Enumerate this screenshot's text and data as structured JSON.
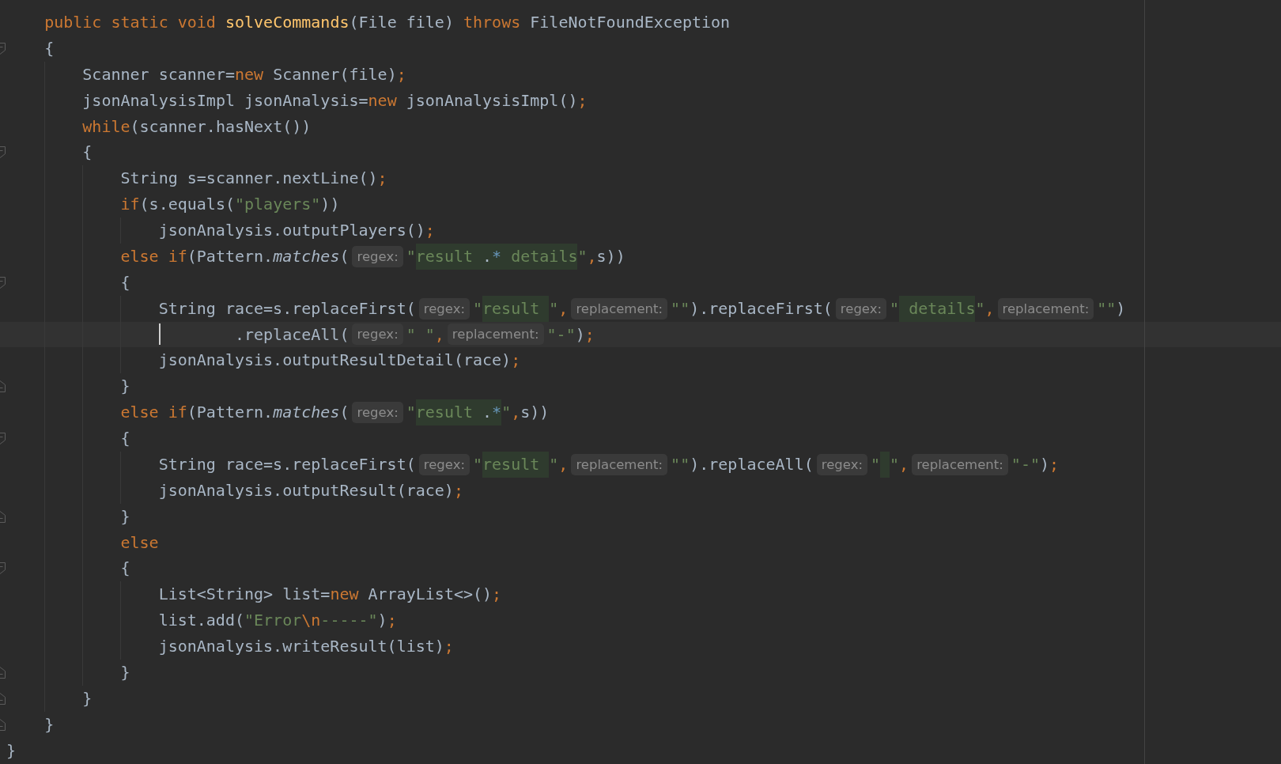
{
  "editor": {
    "lines": [
      {
        "kind": "statement",
        "current": false,
        "tokens": [
          {
            "kind": "keyword",
            "text": "public static void "
          },
          {
            "kind": "method_decl",
            "text": "solveCommands"
          },
          {
            "kind": "plain",
            "text": "(File file) "
          },
          {
            "kind": "keyword",
            "text": "throws "
          },
          {
            "kind": "plain",
            "text": "FileNotFoundException"
          }
        ]
      },
      {
        "kind": "statement",
        "current": false,
        "fold_start": true,
        "tokens": [
          {
            "kind": "plain",
            "text": "{"
          }
        ],
        "children": [
          {
            "kind": "statement",
            "current": false,
            "tokens": [
              {
                "kind": "plain",
                "text": "Scanner scanner="
              },
              {
                "kind": "keyword",
                "text": "new "
              },
              {
                "kind": "plain",
                "text": "Scanner(file)"
              },
              {
                "kind": "separator",
                "text": ";"
              }
            ]
          },
          {
            "kind": "statement",
            "current": false,
            "tokens": [
              {
                "kind": "plain",
                "text": "jsonAnalysisImpl jsonAnalysis="
              },
              {
                "kind": "keyword",
                "text": "new "
              },
              {
                "kind": "plain",
                "text": "jsonAnalysisImpl()"
              },
              {
                "kind": "separator",
                "text": ";"
              }
            ]
          },
          {
            "kind": "statement",
            "current": false,
            "tokens": [
              {
                "kind": "keyword",
                "text": "while"
              },
              {
                "kind": "plain",
                "text": "(scanner.hasNext())"
              }
            ]
          },
          {
            "kind": "statement",
            "current": false,
            "fold_start": true,
            "tokens": [
              {
                "kind": "plain",
                "text": "{"
              }
            ],
            "children": [
              {
                "kind": "statement",
                "current": false,
                "tokens": [
                  {
                    "kind": "plain",
                    "text": "String s=scanner.nextLine()"
                  },
                  {
                    "kind": "separator",
                    "text": ";"
                  }
                ]
              },
              {
                "kind": "statement",
                "current": false,
                "tokens": [
                  {
                    "kind": "keyword",
                    "text": "if"
                  },
                  {
                    "kind": "plain",
                    "text": "(s.equals("
                  },
                  {
                    "kind": "string",
                    "text": "\"players\""
                  },
                  {
                    "kind": "plain",
                    "text": "))"
                  }
                ],
                "children": [
                  {
                    "kind": "statement",
                    "current": false,
                    "tokens": [
                      {
                        "kind": "plain",
                        "text": "jsonAnalysis.outputPlayers()"
                      },
                      {
                        "kind": "separator",
                        "text": ";"
                      }
                    ]
                  }
                ]
              },
              {
                "kind": "statement",
                "current": false,
                "tokens": [
                  {
                    "kind": "keyword",
                    "text": "else if"
                  },
                  {
                    "kind": "plain",
                    "text": "(Pattern."
                  },
                  {
                    "kind": "static_call",
                    "text": "matches"
                  },
                  {
                    "kind": "plain",
                    "text": "("
                  },
                  {
                    "kind": "hint",
                    "text": "regex:"
                  },
                  {
                    "kind": "string",
                    "text": "\""
                  },
                  {
                    "kind": "regex",
                    "text": "result "
                  },
                  {
                    "kind": "regex_char",
                    "text": "."
                  },
                  {
                    "kind": "regex_quantifier",
                    "text": "*"
                  },
                  {
                    "kind": "regex",
                    "text": " details"
                  },
                  {
                    "kind": "string",
                    "text": "\""
                  },
                  {
                    "kind": "separator",
                    "text": ","
                  },
                  {
                    "kind": "plain",
                    "text": "s))"
                  }
                ]
              },
              {
                "kind": "statement",
                "current": false,
                "fold_start": true,
                "tokens": [
                  {
                    "kind": "plain",
                    "text": "{"
                  }
                ],
                "children": [
                  {
                    "kind": "statement",
                    "current": false,
                    "tokens": [
                      {
                        "kind": "plain",
                        "text": "String race=s.replaceFirst("
                      },
                      {
                        "kind": "hint",
                        "text": "regex:"
                      },
                      {
                        "kind": "string",
                        "text": "\""
                      },
                      {
                        "kind": "regex",
                        "text": "result "
                      },
                      {
                        "kind": "string",
                        "text": "\""
                      },
                      {
                        "kind": "separator",
                        "text": ","
                      },
                      {
                        "kind": "hint",
                        "text": "replacement:"
                      },
                      {
                        "kind": "string",
                        "text": "\"\""
                      },
                      {
                        "kind": "plain",
                        "text": ").replaceFirst("
                      },
                      {
                        "kind": "hint",
                        "text": "regex:"
                      },
                      {
                        "kind": "string",
                        "text": "\""
                      },
                      {
                        "kind": "regex",
                        "text": " details"
                      },
                      {
                        "kind": "string",
                        "text": "\""
                      },
                      {
                        "kind": "separator",
                        "text": ","
                      },
                      {
                        "kind": "hint",
                        "text": "replacement:"
                      },
                      {
                        "kind": "string",
                        "text": "\"\""
                      },
                      {
                        "kind": "plain",
                        "text": ")"
                      }
                    ]
                  },
                  {
                    "kind": "continuation",
                    "current": true,
                    "tokens": [
                      {
                        "kind": "plain",
                        "text": ".replaceAll("
                      },
                      {
                        "kind": "hint",
                        "text": "regex:"
                      },
                      {
                        "kind": "string",
                        "text": "\" \""
                      },
                      {
                        "kind": "separator",
                        "text": ","
                      },
                      {
                        "kind": "hint",
                        "text": "replacement:"
                      },
                      {
                        "kind": "string",
                        "text": "\"-\""
                      },
                      {
                        "kind": "plain",
                        "text": ")"
                      },
                      {
                        "kind": "separator",
                        "text": ";"
                      }
                    ]
                  },
                  {
                    "kind": "statement",
                    "current": false,
                    "tokens": [
                      {
                        "kind": "plain",
                        "text": "jsonAnalysis.outputResultDetail(race)"
                      },
                      {
                        "kind": "separator",
                        "text": ";"
                      }
                    ]
                  }
                ]
              },
              {
                "kind": "statement",
                "current": false,
                "fold_end": true,
                "tokens": [
                  {
                    "kind": "plain",
                    "text": "}"
                  }
                ]
              },
              {
                "kind": "statement",
                "current": false,
                "tokens": [
                  {
                    "kind": "keyword",
                    "text": "else if"
                  },
                  {
                    "kind": "plain",
                    "text": "(Pattern."
                  },
                  {
                    "kind": "static_call",
                    "text": "matches"
                  },
                  {
                    "kind": "plain",
                    "text": "("
                  },
                  {
                    "kind": "hint",
                    "text": "regex:"
                  },
                  {
                    "kind": "string",
                    "text": "\""
                  },
                  {
                    "kind": "regex",
                    "text": "result "
                  },
                  {
                    "kind": "regex_char",
                    "text": "."
                  },
                  {
                    "kind": "regex_quantifier",
                    "text": "*"
                  },
                  {
                    "kind": "string",
                    "text": "\""
                  },
                  {
                    "kind": "separator",
                    "text": ","
                  },
                  {
                    "kind": "plain",
                    "text": "s))"
                  }
                ]
              },
              {
                "kind": "statement",
                "current": false,
                "fold_start": true,
                "tokens": [
                  {
                    "kind": "plain",
                    "text": "{"
                  }
                ],
                "children": [
                  {
                    "kind": "statement",
                    "current": false,
                    "tokens": [
                      {
                        "kind": "plain",
                        "text": "String race=s.replaceFirst("
                      },
                      {
                        "kind": "hint",
                        "text": "regex:"
                      },
                      {
                        "kind": "string",
                        "text": "\""
                      },
                      {
                        "kind": "regex",
                        "text": "result "
                      },
                      {
                        "kind": "string",
                        "text": "\""
                      },
                      {
                        "kind": "separator",
                        "text": ","
                      },
                      {
                        "kind": "hint",
                        "text": "replacement:"
                      },
                      {
                        "kind": "string",
                        "text": "\"\""
                      },
                      {
                        "kind": "plain",
                        "text": ").replaceAll("
                      },
                      {
                        "kind": "hint",
                        "text": "regex:"
                      },
                      {
                        "kind": "regex_string",
                        "text": "\" \""
                      },
                      {
                        "kind": "separator",
                        "text": ","
                      },
                      {
                        "kind": "hint",
                        "text": "replacement:"
                      },
                      {
                        "kind": "string",
                        "text": "\"-\""
                      },
                      {
                        "kind": "plain",
                        "text": ")"
                      },
                      {
                        "kind": "separator",
                        "text": ";"
                      }
                    ]
                  },
                  {
                    "kind": "statement",
                    "current": false,
                    "tokens": [
                      {
                        "kind": "plain",
                        "text": "jsonAnalysis.outputResult(race)"
                      },
                      {
                        "kind": "separator",
                        "text": ";"
                      }
                    ]
                  }
                ]
              },
              {
                "kind": "statement",
                "current": false,
                "fold_end": true,
                "tokens": [
                  {
                    "kind": "plain",
                    "text": "}"
                  }
                ]
              },
              {
                "kind": "statement",
                "current": false,
                "tokens": [
                  {
                    "kind": "keyword",
                    "text": "else"
                  }
                ]
              },
              {
                "kind": "statement",
                "current": false,
                "fold_start": true,
                "tokens": [
                  {
                    "kind": "plain",
                    "text": "{"
                  }
                ],
                "children": [
                  {
                    "kind": "statement",
                    "current": false,
                    "tokens": [
                      {
                        "kind": "plain",
                        "text": "List<String> list="
                      },
                      {
                        "kind": "keyword",
                        "text": "new "
                      },
                      {
                        "kind": "plain",
                        "text": "ArrayList<>()"
                      },
                      {
                        "kind": "separator",
                        "text": ";"
                      }
                    ]
                  },
                  {
                    "kind": "statement",
                    "current": false,
                    "tokens": [
                      {
                        "kind": "plain",
                        "text": "list.add("
                      },
                      {
                        "kind": "string",
                        "text": "\"Error"
                      },
                      {
                        "kind": "escape",
                        "text": "\\n"
                      },
                      {
                        "kind": "string",
                        "text": "-----\""
                      },
                      {
                        "kind": "plain",
                        "text": ")"
                      },
                      {
                        "kind": "separator",
                        "text": ";"
                      }
                    ]
                  },
                  {
                    "kind": "statement",
                    "current": false,
                    "tokens": [
                      {
                        "kind": "plain",
                        "text": "jsonAnalysis.writeResult(list)"
                      },
                      {
                        "kind": "separator",
                        "text": ";"
                      }
                    ]
                  }
                ]
              },
              {
                "kind": "statement",
                "current": false,
                "fold_end": true,
                "tokens": [
                  {
                    "kind": "plain",
                    "text": "}"
                  }
                ]
              }
            ]
          },
          {
            "kind": "statement",
            "current": false,
            "fold_end": true,
            "tokens": [
              {
                "kind": "plain",
                "text": "}"
              }
            ]
          }
        ]
      },
      {
        "kind": "statement",
        "current": false,
        "fold_end": true,
        "tokens": [
          {
            "kind": "plain",
            "text": "}"
          }
        ]
      }
    ],
    "class_end": {
      "kind": "statement",
      "current": false,
      "tokens": [
        {
          "kind": "plain",
          "text": "}"
        }
      ]
    }
  }
}
